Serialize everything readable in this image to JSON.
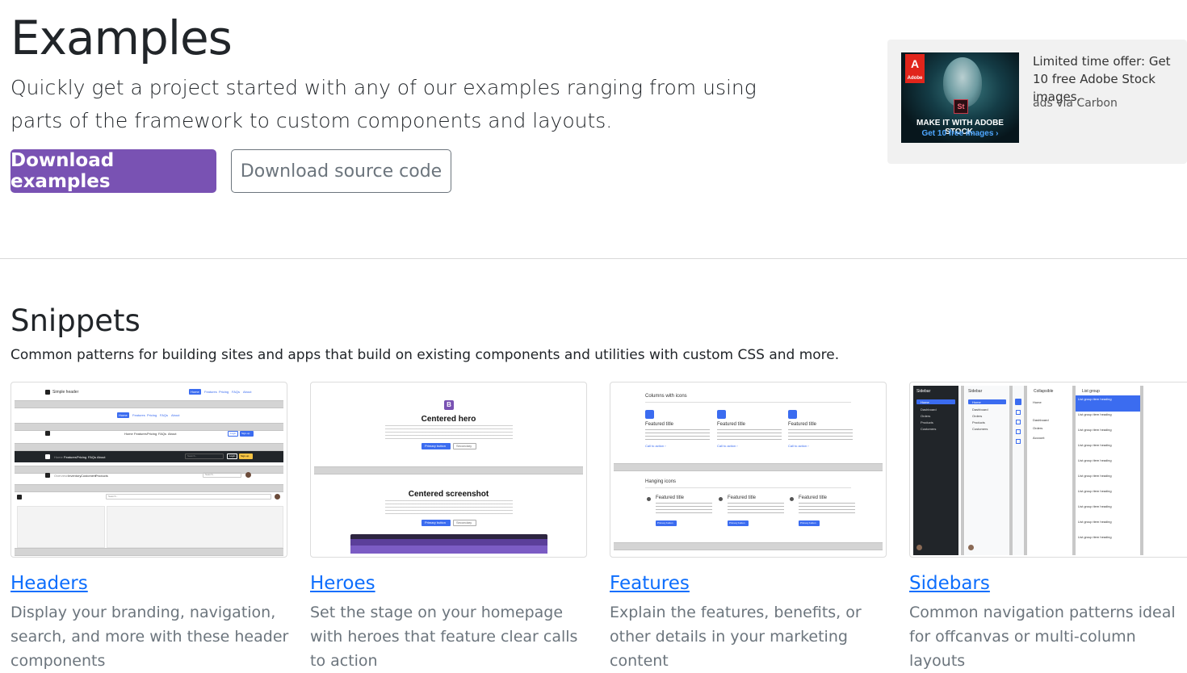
{
  "hero": {
    "title": "Examples",
    "lead": "Quickly get a project started with any of our examples ranging from using parts of the framework to custom components and layouts.",
    "primary_button": "Download examples",
    "secondary_button": "Download source code"
  },
  "carbon": {
    "text": "Limited time offer: Get 10 free Adobe Stock images.",
    "via": "ads via Carbon",
    "image_logo": "Adobe",
    "image_badge": "St",
    "image_tagline": "MAKE IT WITH ADOBE STOCK.",
    "image_cta": "Get 10 free images ›"
  },
  "snippets": {
    "title": "Snippets",
    "lead": "Common patterns for building sites and apps that build on existing components and utilities with custom CSS and more.",
    "cards": [
      {
        "title": "Headers",
        "desc": "Display your branding, navigation, search, and more with these header components",
        "thumb": {
          "brand": "Simple header",
          "nav": [
            "Home",
            "Features",
            "Pricing",
            "FAQs",
            "About"
          ],
          "login": "Login",
          "signup": "Sign-up",
          "search": "Search...",
          "dark_nav": [
            "Home",
            "Features",
            "Pricing",
            "FAQs",
            "About"
          ],
          "nav3": [
            "Overview",
            "Inventory",
            "Customers",
            "Products"
          ]
        }
      },
      {
        "title": "Heroes",
        "desc": "Set the stage on your homepage with heroes that feature clear calls to action",
        "thumb": {
          "hero1": "Centered hero",
          "hero2": "Centered screenshot",
          "badge": "B",
          "btn1": "Primary button",
          "btn2": "Secondary"
        }
      },
      {
        "title": "Features",
        "desc": "Explain the features, benefits, or other details in your marketing content",
        "thumb": {
          "section1": "Columns with icons",
          "section2": "Hanging icons",
          "feature": "Featured title",
          "link": "Call to action ›",
          "btn": "Primary button"
        }
      },
      {
        "title": "Sidebars",
        "desc": "Common navigation patterns ideal for offcanvas or multi-column layouts",
        "thumb": {
          "sidebar": "Sidebar",
          "items": [
            "Home",
            "Dashboard",
            "Orders",
            "Products",
            "Customers"
          ],
          "collapsible": "Collapsible",
          "collapse_items": [
            "Home",
            "Dashboard",
            "Orders",
            "Account"
          ],
          "list_group": "List group",
          "list_item": "List group item heading"
        }
      }
    ]
  },
  "colors": {
    "brand": "#7952b3",
    "link": "#0d6efd",
    "thumb_primary": "#3b6cf0"
  }
}
